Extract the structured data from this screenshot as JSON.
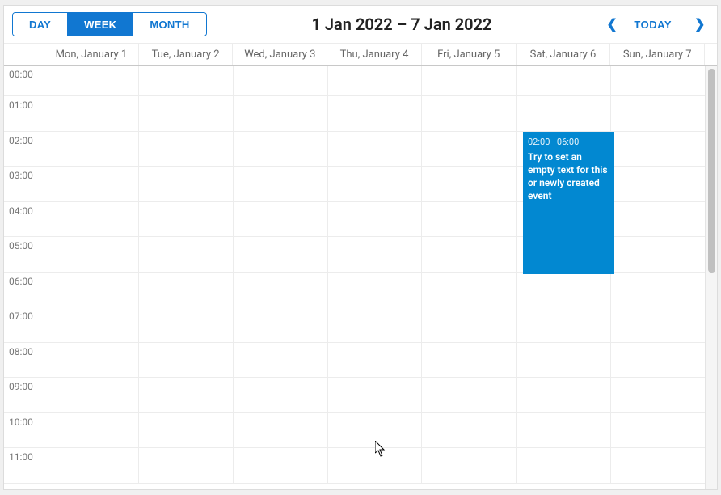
{
  "toolbar": {
    "views": {
      "day": "DAY",
      "week": "WEEK",
      "month": "MONTH",
      "active": "week"
    },
    "title": "1 Jan 2022 – 7 Jan 2022",
    "today": "TODAY"
  },
  "dayHeaders": [
    "Mon, January 1",
    "Tue, January 2",
    "Wed, January 3",
    "Thu, January 4",
    "Fri, January 5",
    "Sat, January 6",
    "Sun, January 7"
  ],
  "hours": [
    "00:00",
    "01:00",
    "02:00",
    "03:00",
    "04:00",
    "05:00",
    "06:00",
    "07:00",
    "08:00",
    "09:00",
    "10:00",
    "11:00"
  ],
  "event": {
    "time": "02:00 - 06:00",
    "text": "Try to set an empty text for this or newly created event"
  },
  "colors": {
    "accent": "#1177d1",
    "event": "#0288d1"
  }
}
